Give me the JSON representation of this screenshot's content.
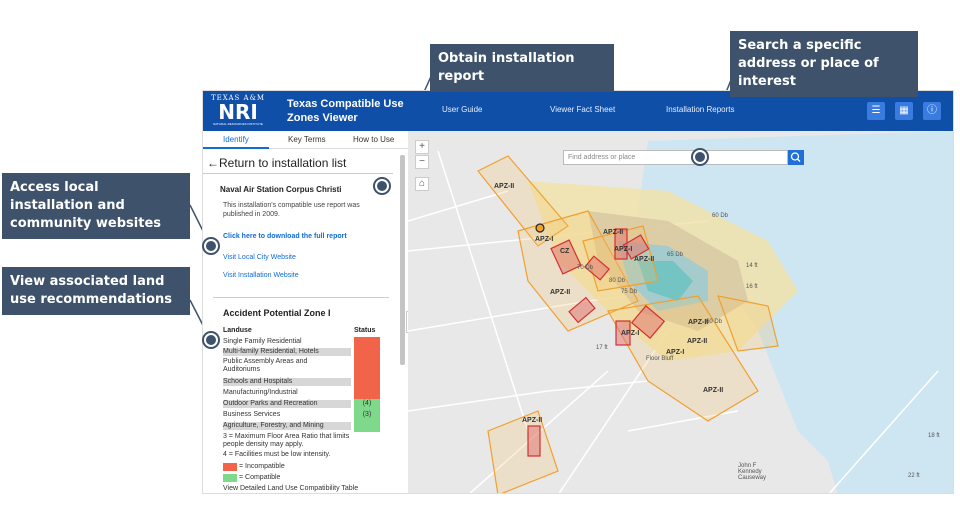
{
  "callouts": {
    "report": "Obtain installation report",
    "search": "Search a specific address or place of interest",
    "websites": "Access local installation and community websites",
    "landuse": "View associated land use recommendations"
  },
  "header": {
    "logo_top": "TEXAS A&M",
    "logo_main": "NRI",
    "logo_sub": "NATURAL RESOURCES INSTITUTE",
    "title": "Texas Compatible Use Zones Viewer",
    "nav": [
      "User Guide",
      "Viewer Fact Sheet",
      "Installation Reports"
    ],
    "icons": [
      "list-icon",
      "grid-icon",
      "info-icon"
    ]
  },
  "tabs": [
    "Identify",
    "Key Terms",
    "How to Use"
  ],
  "panel": {
    "return": "←Return to installation list",
    "installation": "Naval Air Station Corpus Christi",
    "description": "This installation's compatible use report was published in 2009.",
    "download": "Click here to download the full report",
    "city_site": "Visit Local City Website",
    "inst_site": "Visit Installation Website",
    "zone_title": "Accident Potential Zone I",
    "col_landuse": "Landuse",
    "col_status": "Status",
    "rows": [
      {
        "name": "Single Family Residential",
        "status": ""
      },
      {
        "name": "Multi-family Residential, Hotels",
        "status": ""
      },
      {
        "name": "Public Assembly Areas and Auditoriums",
        "status": ""
      },
      {
        "name": "Schools and Hospitals",
        "status": ""
      },
      {
        "name": "Manufacturing/Industrial",
        "status": ""
      },
      {
        "name": "Outdoor Parks and Recreation",
        "status": "(4)"
      },
      {
        "name": "Business Services",
        "status": "(3)"
      },
      {
        "name": "Agriculture, Forestry, and Mining",
        "status": ""
      }
    ],
    "note3": "3 = Maximum Floor Area Ratio that limits people density may apply.",
    "note4": "4 = Facilities must be low intensity.",
    "legend_incompatible": "= Incompatible",
    "legend_compatible": "= Compatible",
    "table_link": "View Detailed Land Use Compatibility Table"
  },
  "colors": {
    "incompatible": "#f26449",
    "compatible": "#7fd98a",
    "header": "#0f4fa8",
    "callout": "#3e536b"
  },
  "map": {
    "search_placeholder": "Find address or place",
    "zoom_in": "+",
    "zoom_out": "−",
    "labels": {
      "apz2_a": "APZ-II",
      "apz1_a": "APZ-I",
      "apz2_b": "APZ-II",
      "apz2_c": "APZ-II",
      "cz": "CZ",
      "db60a": "60 Db",
      "db60b": "60 Db",
      "db70": "70 Db",
      "db75": "75 Db",
      "db80": "80 Db",
      "db65": "65 Db",
      "apz1_b": "APZ-I",
      "apz2_d": "APZ-II",
      "apz2_e": "APZ-II",
      "apz1_c": "APZ-I",
      "apz2_f": "APZ-II",
      "apz2_g": "APZ-II",
      "apz1_d": "APZ-I",
      "apz2_h": "APZ-II",
      "floor_bluff": "Floor Bluff",
      "causeway": "John F Kennedy Causeway",
      "ft16": "16 ft",
      "ft14": "14 ft",
      "ft17": "17 ft",
      "ft18": "18 ft",
      "ft22": "22 ft"
    }
  }
}
